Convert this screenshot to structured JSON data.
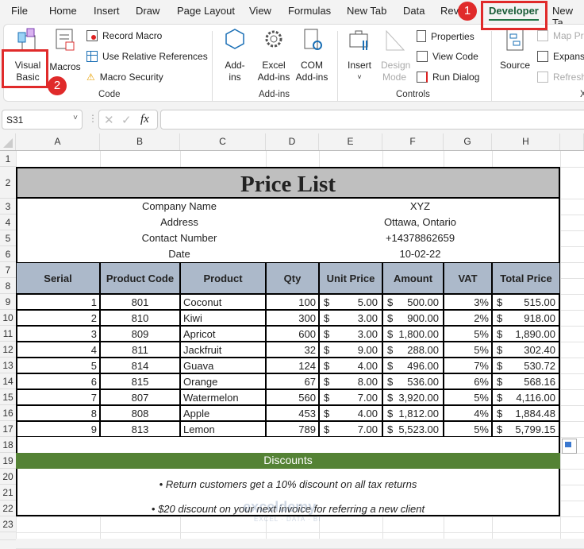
{
  "menu": {
    "tabs": [
      "File",
      "Home",
      "Insert",
      "Draw",
      "Page Layout",
      "View",
      "Formulas",
      "New Tab",
      "Data",
      "Review",
      "Developer",
      "New Ta"
    ],
    "active": "Developer"
  },
  "ribbon": {
    "code": {
      "visual_basic": "Visual Basic",
      "macros": "Macros",
      "record_macro": "Record Macro",
      "relative_refs": "Use Relative References",
      "macro_security": "Macro Security",
      "label": "Code"
    },
    "addins": {
      "addins": "Add-ins",
      "excel_addins": "Excel Add-ins",
      "com_addins": "COM Add-ins",
      "label": "Add-ins"
    },
    "controls": {
      "insert": "Insert",
      "design_mode": "Design Mode",
      "properties": "Properties",
      "view_code": "View Code",
      "run_dialog": "Run Dialog",
      "label": "Controls"
    },
    "xml": {
      "source": "Source",
      "map_properties": "Map Pro",
      "expansion_packs": "Expansi",
      "refresh_data": "Refresh",
      "label": "X"
    }
  },
  "annotations": {
    "step1": "1",
    "step2": "2"
  },
  "formula_bar": {
    "name_box": "S31",
    "fx": "fx",
    "value": ""
  },
  "columns": [
    "A",
    "B",
    "C",
    "D",
    "E",
    "F",
    "G",
    "H"
  ],
  "rows": [
    "1",
    "2",
    "3",
    "4",
    "5",
    "6",
    "7",
    "8",
    "9",
    "10",
    "11",
    "12",
    "13",
    "14",
    "15",
    "16",
    "17",
    "18",
    "19",
    "20",
    "21",
    "22",
    "23"
  ],
  "sheet": {
    "title": "Price List",
    "info": [
      {
        "label": "Company Name",
        "value": "XYZ"
      },
      {
        "label": "Address",
        "value": "Ottawa, Ontario"
      },
      {
        "label": "Contact Number",
        "value": "+14378862659"
      },
      {
        "label": "Date",
        "value": "10-02-22"
      }
    ],
    "headers": [
      "Serial",
      "Product Code",
      "Product",
      "Qty",
      "Unit Price",
      "Amount",
      "VAT",
      "Total Price"
    ],
    "currency": "$",
    "items": [
      [
        "1",
        "801",
        "Coconut",
        "100",
        "5.00",
        "500.00",
        "3%",
        "515.00"
      ],
      [
        "2",
        "810",
        "Kiwi",
        "300",
        "3.00",
        "900.00",
        "2%",
        "918.00"
      ],
      [
        "3",
        "809",
        "Apricot",
        "600",
        "3.00",
        "1,800.00",
        "5%",
        "1,890.00"
      ],
      [
        "4",
        "811",
        "Jackfruit",
        "32",
        "9.00",
        "288.00",
        "5%",
        "302.40"
      ],
      [
        "5",
        "814",
        "Guava",
        "124",
        "4.00",
        "496.00",
        "7%",
        "530.72"
      ],
      [
        "6",
        "815",
        "Orange",
        "67",
        "8.00",
        "536.00",
        "6%",
        "568.16"
      ],
      [
        "7",
        "807",
        "Watermelon",
        "560",
        "7.00",
        "3,920.00",
        "5%",
        "4,116.00"
      ],
      [
        "8",
        "808",
        "Apple",
        "453",
        "4.00",
        "1,812.00",
        "4%",
        "1,884.48"
      ],
      [
        "9",
        "813",
        "Lemon",
        "789",
        "7.00",
        "5,523.00",
        "5%",
        "5,799.15"
      ]
    ],
    "discounts_title": "Discounts",
    "discounts": [
      "• Return customers get a 10% discount on all tax returns",
      "• $20 discount on your next invoice for referring a new client"
    ]
  },
  "watermark": {
    "name": "exceldemy",
    "tagline": "EXCEL · DATA · BI"
  },
  "colors": {
    "header_fill": "#acb9ca",
    "title_fill": "#bfbfbf",
    "discount_fill": "#548235",
    "accent_red": "#e02a2a",
    "tab_green": "#217346"
  }
}
